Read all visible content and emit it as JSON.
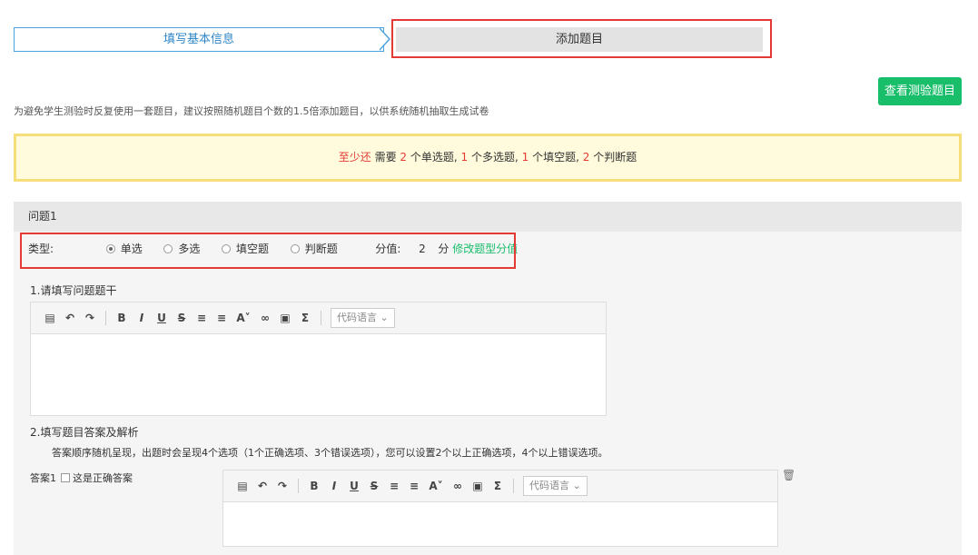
{
  "steps": {
    "step1": "填写基本信息",
    "step2": "添加题目"
  },
  "view_button": "查看测验题目",
  "hint": "为避免学生测验时反复使用一套题目，建议按照随机题目个数的1.5倍添加题目，以供系统随机抽取生成试卷",
  "notice": {
    "prefix": "至少还",
    "need": "需要",
    "n1": "2",
    "t1": "个单选题,",
    "n2": "1",
    "t2": "个多选题,",
    "n3": "1",
    "t3": "个填空题,",
    "n4": "2",
    "t4": "个判断题"
  },
  "question": {
    "title": "问题1",
    "type_label": "类型:",
    "types": [
      "单选",
      "多选",
      "填空题",
      "判断题"
    ],
    "selected_type": "单选",
    "score_label": "分值:",
    "score_value": "2",
    "score_unit": "分",
    "modify_link": "修改题型分值",
    "stem_label": "1.请填写问题题干",
    "answer_label": "2.填写题目答案及解析",
    "answer_desc": "答案顺序随机呈现，出题时会呈现4个选项（1个正确选项、3个错误选项），您可以设置2个以上正确选项，4个以上错误选项。",
    "answer1_label": "答案1",
    "correct_label": "这是正确答案"
  },
  "toolbar": {
    "code_lang": "代码语言"
  },
  "colors": {
    "accent_green": "#19be6b",
    "highlight_red": "#e53935",
    "step_blue": "#4aa3df"
  }
}
